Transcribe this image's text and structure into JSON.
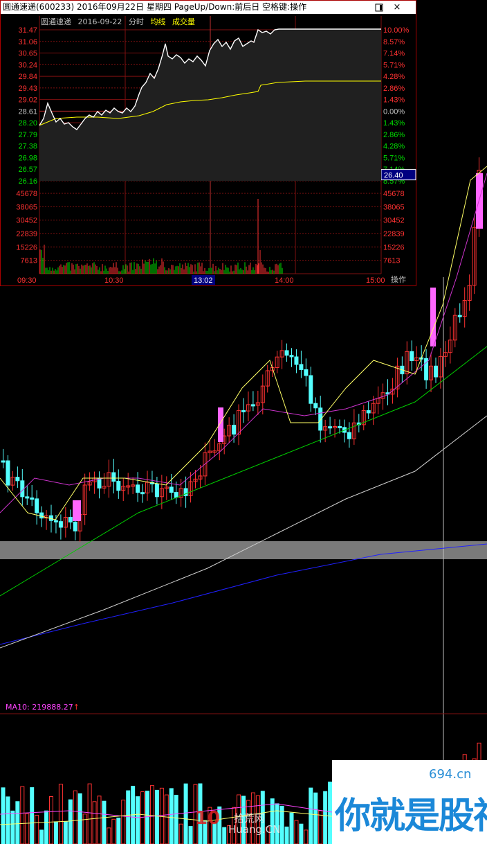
{
  "popup": {
    "title": "圆通速递(600233)  2016年09月22日  星期四  PageUp/Down:前后日  空格键:操作",
    "minimize_icon": "minimize-icon",
    "close_icon": "close-icon",
    "close_glyph": "×",
    "legend": {
      "stock_name": "圆通速递",
      "date": "2016-09-22",
      "mode": "分时",
      "avg_line_label": "均线",
      "volume_label": "成交量"
    },
    "price_labels_left": [
      "31.47",
      "31.06",
      "30.65",
      "30.24",
      "29.84",
      "29.43",
      "29.02",
      "28.61",
      "28.20",
      "27.79",
      "27.38",
      "26.98",
      "26.57",
      "26.16"
    ],
    "pct_labels_right": [
      "10.00%",
      "8.57%",
      "7.14%",
      "5.71%",
      "4.28%",
      "2.86%",
      "1.43%",
      "0.00%",
      "1.43%",
      "2.86%",
      "4.28%",
      "5.71%",
      "7.14%",
      "8.57%"
    ],
    "volume_labels_left": [
      "45678",
      "38065",
      "30452",
      "22839",
      "15226",
      "7613"
    ],
    "volume_labels_right": [
      "45678",
      "38065",
      "30452",
      "22839",
      "15226",
      "7613"
    ],
    "cursor_price_tag": "26.40",
    "time_labels": [
      "09:30",
      "10:30",
      "13:02",
      "14:00",
      "15:00"
    ],
    "ops_button": "操作",
    "colors": {
      "up": "#ff3232",
      "down": "#54ffff",
      "flat": "#c0c0c0",
      "avg_line": "#ffff00",
      "price_line": "#ffffff",
      "grid": "#801010",
      "cursor_tag_bg": "#000080"
    }
  },
  "indicator": {
    "ma10_label": "MA10: 219888.27",
    "arrow": "↑"
  },
  "watermarks": {
    "site_domain": "694.cn",
    "site_slogan": "你就是股神",
    "logo_number": "10",
    "logo_cn": "拾荒网",
    "logo_en": "Huang.CN"
  }
}
